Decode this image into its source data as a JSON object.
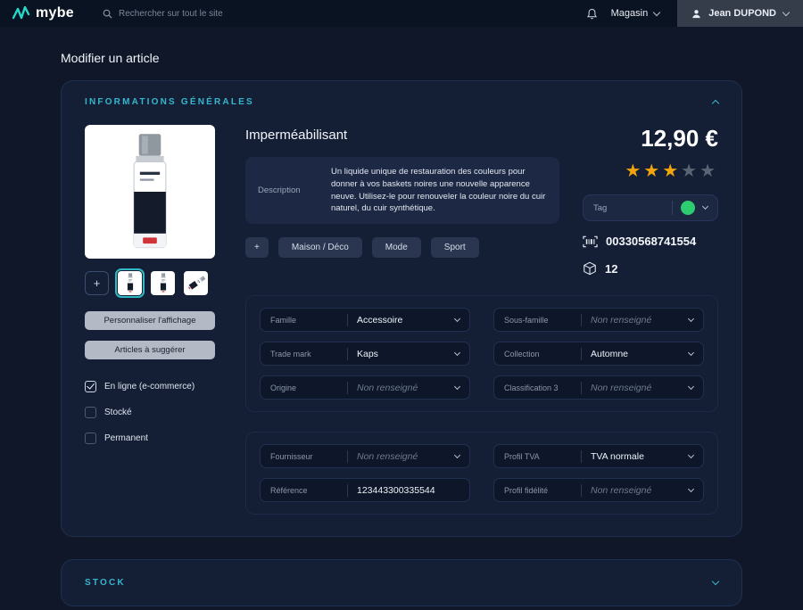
{
  "topbar": {
    "brand": "mybe",
    "search": {
      "placeholder": "Rechercher sur tout le site"
    },
    "store": {
      "label": "Magasin"
    },
    "user": {
      "name": "Jean DUPOND"
    }
  },
  "page": {
    "title": "Modifier un article"
  },
  "general": {
    "title": "INFORMATIONS GÉNÉRALES",
    "product": {
      "name": "Imperméabilisant",
      "description_label": "Description",
      "description_text": "Un liquide unique de restauration des couleurs pour donner à vos baskets noires une nouvelle apparence neuve. Utilisez-le pour renouveler la couleur noire du cuir naturel, du cuir synthétique.",
      "add_chip": "+",
      "chips": [
        "Maison / Déco",
        "Mode",
        "Sport"
      ],
      "price": "12,90 €",
      "rating_filled": 3,
      "rating_total": 5,
      "tag_label": "Tag",
      "tag_color": "#2ecc71",
      "barcode_value": "00330568741554",
      "package_count": "12"
    },
    "sidebar": {
      "add_photo": "+",
      "customize_label": "Personnaliser l'affichage",
      "suggest_label": "Articles à suggérer",
      "checkboxes": [
        {
          "label": "En ligne (e-commerce)",
          "checked": true
        },
        {
          "label": "Stocké",
          "checked": false
        },
        {
          "label": "Permanent",
          "checked": false
        }
      ]
    },
    "form": {
      "group1": [
        {
          "left": {
            "label": "Famille",
            "value": "Accessoire"
          },
          "right": {
            "label": "Sous-famille",
            "value": "Non renseigné"
          }
        },
        {
          "left": {
            "label": "Trade mark",
            "value": "Kaps"
          },
          "right": {
            "label": "Collection",
            "value": "Automne"
          }
        },
        {
          "left": {
            "label": "Origine",
            "value": "Non renseigné"
          },
          "right": {
            "label": "Classification 3",
            "value": "Non renseigné"
          }
        }
      ],
      "group2": [
        {
          "left": {
            "label": "Fournisseur",
            "value": "Non renseigné"
          },
          "right": {
            "label": "Profil TVA",
            "value": "TVA normale"
          }
        },
        {
          "left": {
            "label": "Référence",
            "value": "123443300335544"
          },
          "right": {
            "label": "Profil fidélité",
            "value": "Non renseigné"
          }
        }
      ]
    }
  },
  "stock": {
    "title": "STOCK"
  }
}
